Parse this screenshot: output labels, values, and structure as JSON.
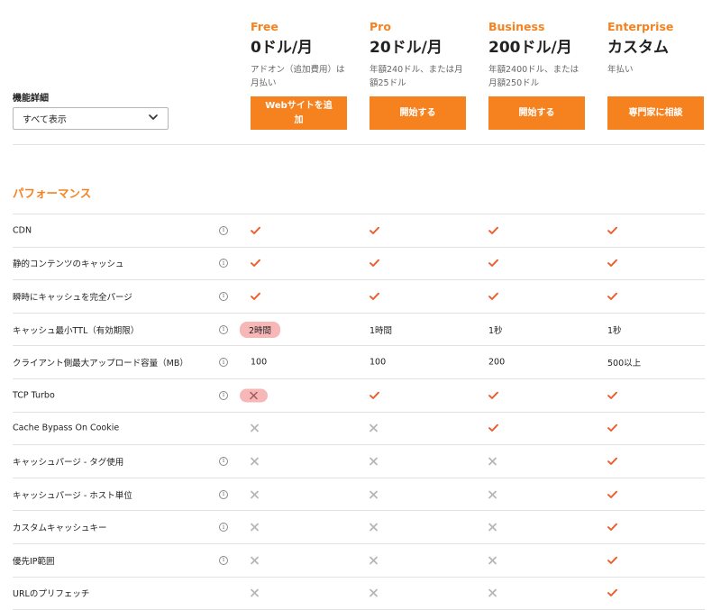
{
  "filter": {
    "label": "機能詳細",
    "selected": "すべて表示"
  },
  "plans": [
    {
      "name": "Free",
      "price": "0ドル/月",
      "note": "アドオン（追加費用）は月払い",
      "button": "Webサイトを追加"
    },
    {
      "name": "Pro",
      "price": "20ドル/月",
      "note": "年額240ドル、または月額25ドル",
      "button": "開始する"
    },
    {
      "name": "Business",
      "price": "200ドル/月",
      "note": "年額2400ドル、または月額250ドル",
      "button": "開始する"
    },
    {
      "name": "Enterprise",
      "price": "カスタム",
      "note": "年払い",
      "button": "専門家に相談"
    }
  ],
  "section": {
    "title": "パフォーマンス"
  },
  "colors": {
    "accent": "#f6821f",
    "check": "#f05a28",
    "cross": "#b5b5b5",
    "highlight": "#f7b7b7"
  },
  "features": [
    {
      "label": "CDN",
      "info": true,
      "values": [
        "check",
        "check",
        "check",
        "check"
      ]
    },
    {
      "label": "静的コンテンツのキャッシュ",
      "info": true,
      "values": [
        "check",
        "check",
        "check",
        "check"
      ]
    },
    {
      "label": "瞬時にキャッシュを完全パージ",
      "info": true,
      "values": [
        "check",
        "check",
        "check",
        "check"
      ]
    },
    {
      "label": "キャッシュ最小TTL（有効期限）",
      "info": true,
      "values": [
        "pill:2時間",
        "1時間",
        "1秒",
        "1秒"
      ]
    },
    {
      "label": "クライアント側最大アップロード容量（MB）",
      "info": true,
      "values": [
        "100",
        "100",
        "200",
        "500以上"
      ]
    },
    {
      "label": "TCP Turbo",
      "info": true,
      "values": [
        "pillcross",
        "check",
        "check",
        "check"
      ]
    },
    {
      "label": "Cache Bypass On Cookie",
      "info": false,
      "values": [
        "cross",
        "cross",
        "check",
        "check"
      ]
    },
    {
      "label": "キャッシュパージ - タグ使用",
      "info": true,
      "values": [
        "cross",
        "cross",
        "cross",
        "check"
      ]
    },
    {
      "label": "キャッシュパージ - ホスト単位",
      "info": true,
      "values": [
        "cross",
        "cross",
        "cross",
        "check"
      ]
    },
    {
      "label": "カスタムキャッシュキー",
      "info": true,
      "values": [
        "cross",
        "cross",
        "cross",
        "check"
      ]
    },
    {
      "label": "優先IP範囲",
      "info": true,
      "values": [
        "cross",
        "cross",
        "cross",
        "check"
      ]
    },
    {
      "label": "URLのプリフェッチ",
      "info": false,
      "values": [
        "cross",
        "cross",
        "cross",
        "check"
      ]
    }
  ]
}
